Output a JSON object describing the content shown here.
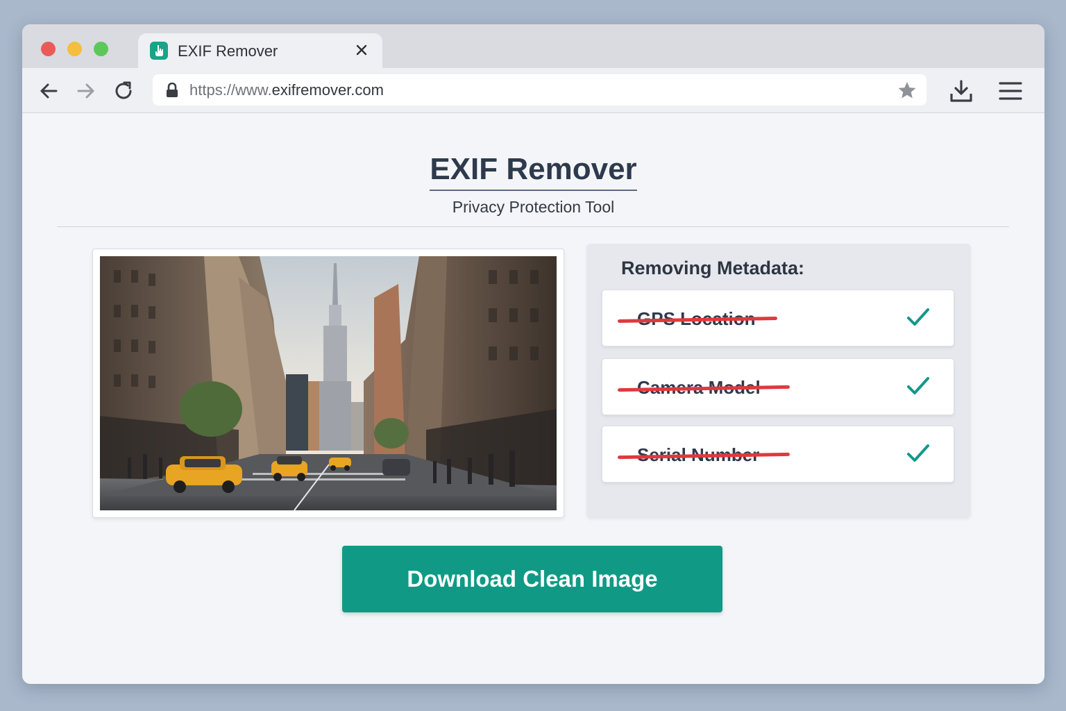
{
  "browser": {
    "tab_title": "EXIF Remover",
    "url_protocol": "https://www.",
    "url_domain": "exifremover.com"
  },
  "page": {
    "title": "EXIF Remover",
    "subtitle": "Privacy Protection Tool"
  },
  "metadata_panel": {
    "heading": "Removing Metadata:",
    "items": [
      {
        "label": "GPS Location",
        "status": "removed"
      },
      {
        "label": "Camera Model",
        "status": "removed"
      },
      {
        "label": "Serial Number",
        "status": "removed"
      }
    ]
  },
  "download_label": "Download Clean Image",
  "colors": {
    "accent": "#109a86",
    "strike": "#e0393e",
    "check": "#12988a"
  },
  "icons": [
    "app-favicon-icon",
    "close-icon",
    "back-arrow-icon",
    "forward-arrow-icon",
    "reload-icon",
    "lock-icon",
    "star-icon",
    "download-icon",
    "menu-icon",
    "check-icon"
  ]
}
